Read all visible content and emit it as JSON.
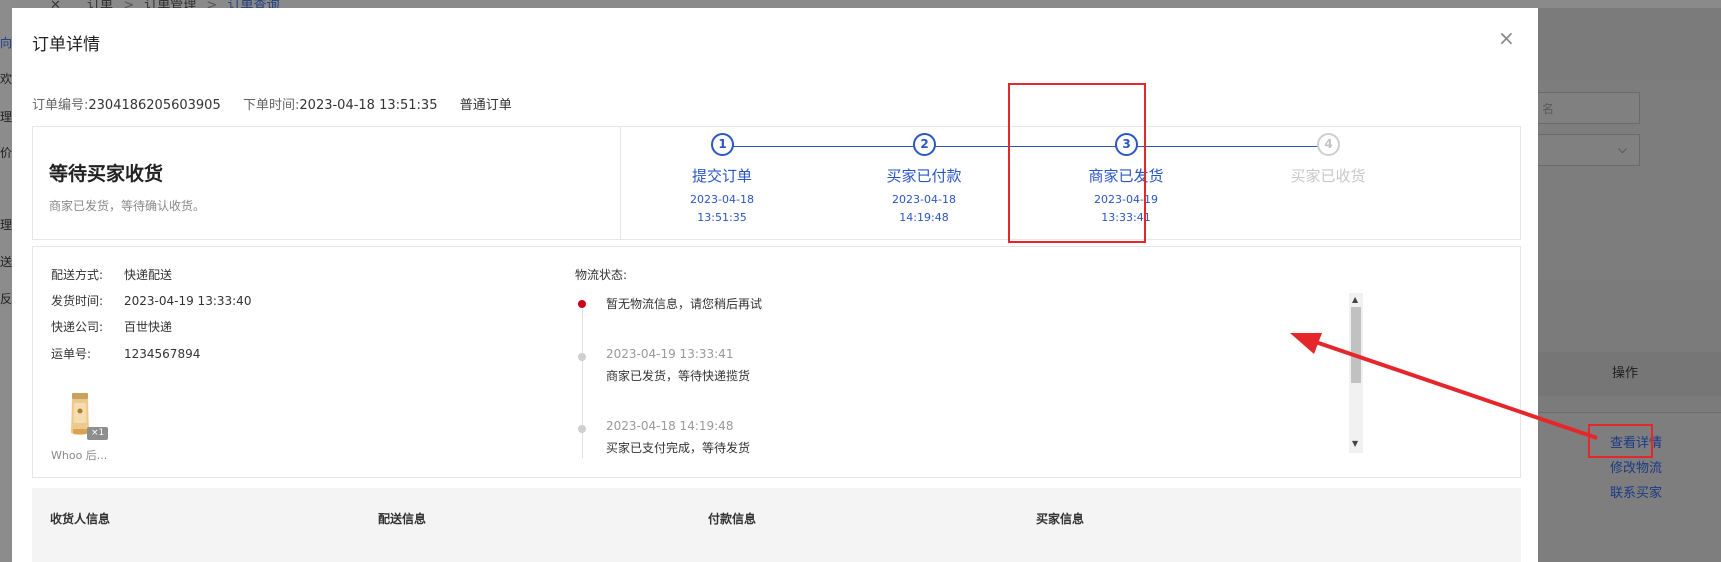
{
  "background": {
    "breadcrumb": [
      "订单",
      "订单管理",
      "订单查询"
    ],
    "breadcrumb_seps": [
      ">",
      ">"
    ],
    "side_chars": [
      "向",
      "欢",
      "理",
      "价",
      "理",
      "送",
      "反"
    ],
    "search_placeholder": "名",
    "table_header_op": "操作",
    "row_links": {
      "view_detail": "查看详情",
      "edit_logistics": "修改物流",
      "contact_buyer": "联系买家"
    }
  },
  "modal": {
    "title": "订单详情",
    "close_icon": "close-icon",
    "order_no_label": "订单编号:",
    "order_no": "2304186205603905",
    "order_time_label": "下单时间:",
    "order_time": "2023-04-18 13:51:35",
    "order_type": "普通订单",
    "status": {
      "title": "等待买家收货",
      "desc": "商家已发货，等待确认收货。"
    },
    "steps": [
      {
        "num": "1",
        "label": "提交订单",
        "date": "2023-04-18",
        "time": "13:51:35",
        "done": true
      },
      {
        "num": "2",
        "label": "买家已付款",
        "date": "2023-04-18",
        "time": "14:19:48",
        "done": true
      },
      {
        "num": "3",
        "label": "商家已发货",
        "date": "2023-04-19",
        "time": "13:33:41",
        "done": true
      },
      {
        "num": "4",
        "label": "买家已收货",
        "date": "",
        "time": "",
        "done": false
      }
    ],
    "delivery": {
      "method_label": "配送方式:",
      "method": "快递配送",
      "ship_time_label": "发货时间:",
      "ship_time": "2023-04-19 13:33:40",
      "company_label": "快递公司:",
      "company": "百世快递",
      "waybill_label": "运单号:",
      "waybill": "1234567894"
    },
    "product": {
      "qty": "×1",
      "name": "Whoo 后..."
    },
    "logistics": {
      "title": "物流状态:",
      "entries": [
        {
          "time": "",
          "text": "暂无物流信息，请您稍后再试"
        },
        {
          "time": "2023-04-19 13:33:41",
          "text": "商家已发货，等待快递揽货"
        },
        {
          "time": "2023-04-18 14:19:48",
          "text": "买家已支付完成，等待发货"
        }
      ]
    },
    "bottom_sections": [
      "收货人信息",
      "配送信息",
      "付款信息",
      "买家信息"
    ]
  },
  "colors": {
    "accent": "#2a56c6",
    "annotation_red": "#e5262b",
    "status_red": "#d0021b"
  }
}
